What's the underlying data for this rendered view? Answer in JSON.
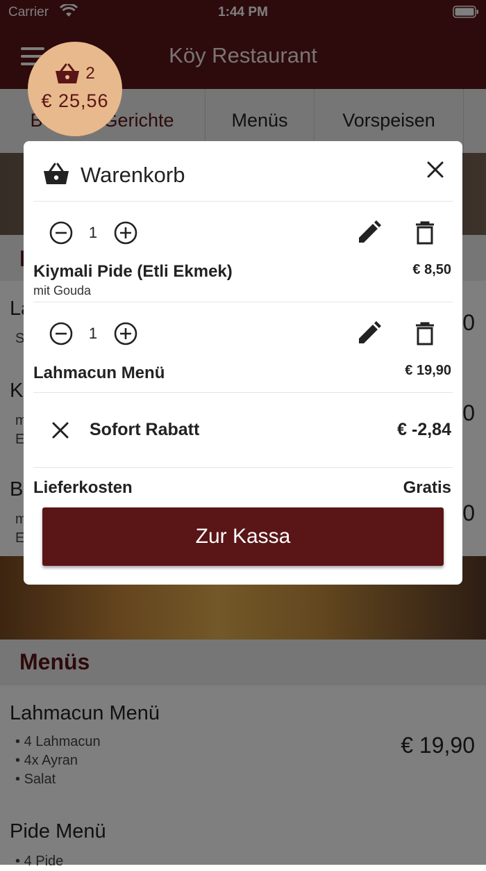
{
  "status_bar": {
    "carrier": "Carrier",
    "time": "1:44 PM"
  },
  "app": {
    "title": "Köy Restaurant"
  },
  "cart_bubble": {
    "count": "2",
    "total": "€ 25,56"
  },
  "tabs": [
    {
      "label": "Beliebte Gerichte",
      "active": true
    },
    {
      "label": "Menüs",
      "active": false
    },
    {
      "label": "Vorspeisen",
      "active": false
    }
  ],
  "background": {
    "section1_initial": "B",
    "items_partial": [
      {
        "initial": "La",
        "sub": "S",
        "price_fragment": "0"
      },
      {
        "initial": "K",
        "sub": "m\nE",
        "price_fragment": "0"
      },
      {
        "initial": "B",
        "sub": "m\nE",
        "price_fragment": "0"
      }
    ],
    "menus_section": "Menüs",
    "menu_items": [
      {
        "name": "Lahmacun Menü",
        "bullets": [
          "4 Lahmacun",
          "4x Ayran",
          "Salat"
        ],
        "price": "€ 19,90"
      },
      {
        "name": "Pide Menü",
        "bullets": [
          "4 Pide"
        ],
        "price": ""
      }
    ]
  },
  "cart_modal": {
    "title": "Warenkorb",
    "items": [
      {
        "qty": "1",
        "name": "Kiymali Pide (Etli Ekmek)",
        "extra": "mit Gouda",
        "price": "€ 8,50"
      },
      {
        "qty": "1",
        "name": "Lahmacun Menü",
        "extra": "",
        "price": "€ 19,90"
      }
    ],
    "discount": {
      "label": "Sofort Rabatt",
      "value": "€ -2,84"
    },
    "delivery": {
      "label": "Lieferkosten",
      "value": "Gratis"
    },
    "checkout_label": "Zur Kassa"
  },
  "colors": {
    "brand": "#5a1517",
    "bubble": "#e8b98c"
  }
}
